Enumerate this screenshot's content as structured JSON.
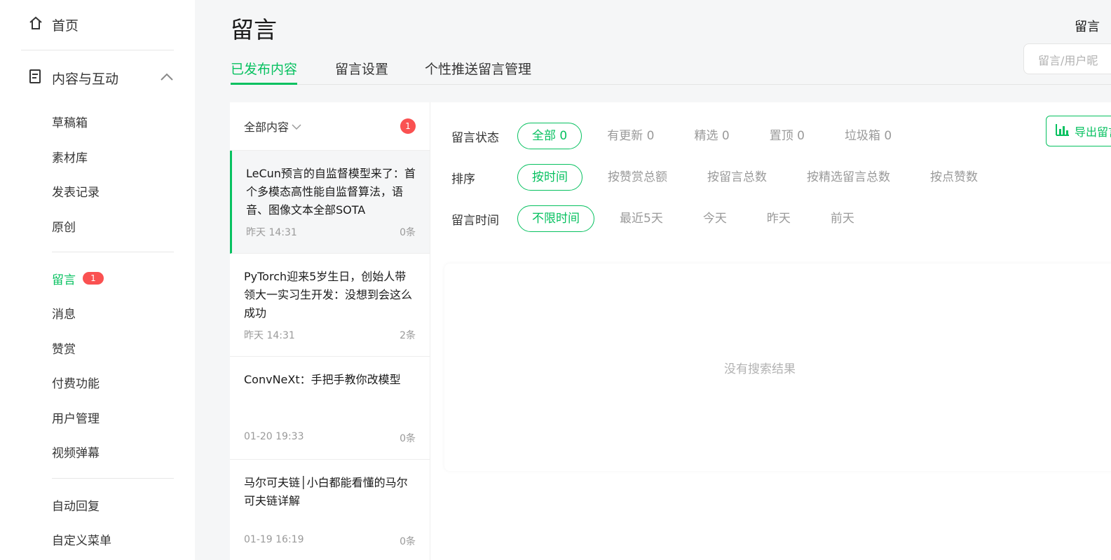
{
  "sidebar": {
    "home": "首页",
    "section": "内容与互动",
    "items_group1": [
      "草稿箱",
      "素材库",
      "发表记录",
      "原创"
    ],
    "comments_label": "留言",
    "comments_badge": "1",
    "items_group2": [
      "消息",
      "赞赏",
      "付费功能",
      "用户管理",
      "视频弹幕"
    ],
    "items_group3": [
      "自动回复",
      "自定义菜单"
    ]
  },
  "header": {
    "title": "留言",
    "top_right": "留言",
    "search_placeholder": "留言/用户昵"
  },
  "tabs": [
    "已发布内容",
    "留言设置",
    "个性推送留言管理"
  ],
  "article_list": {
    "filter_label": "全部内容",
    "unread_count": "1",
    "items": [
      {
        "title": "LeCun预言的自监督模型来了：首个多模态高性能自监督算法，语音、图像文本全部SOTA",
        "time": "昨天 14:31",
        "count": "0条"
      },
      {
        "title": "PyTorch迎来5岁生日，创始人带领大一实习生开发：没想到会这么成功",
        "time": "昨天 14:31",
        "count": "2条"
      },
      {
        "title": "ConvNeXt：手把手教你改模型",
        "time": "01-20 19:33",
        "count": "0条"
      },
      {
        "title": "马尔可夫链│小白都能看懂的马尔可夫链详解",
        "time": "01-19 16:19",
        "count": "0条"
      }
    ]
  },
  "filters": {
    "status_label": "留言状态",
    "status_options": [
      "全部 0",
      "有更新 0",
      "精选 0",
      "置顶 0",
      "垃圾箱 0"
    ],
    "sort_label": "排序",
    "sort_options": [
      "按时间",
      "按赞赏总额",
      "按留言总数",
      "按精选留言总数",
      "按点赞数"
    ],
    "time_label": "留言时间",
    "time_options": [
      "不限时间",
      "最近5天",
      "今天",
      "昨天",
      "前天"
    ],
    "export_label": "导出留言",
    "empty_text": "没有搜索结果"
  },
  "colors": {
    "accent": "#07c160",
    "badge": "#fa5151"
  }
}
